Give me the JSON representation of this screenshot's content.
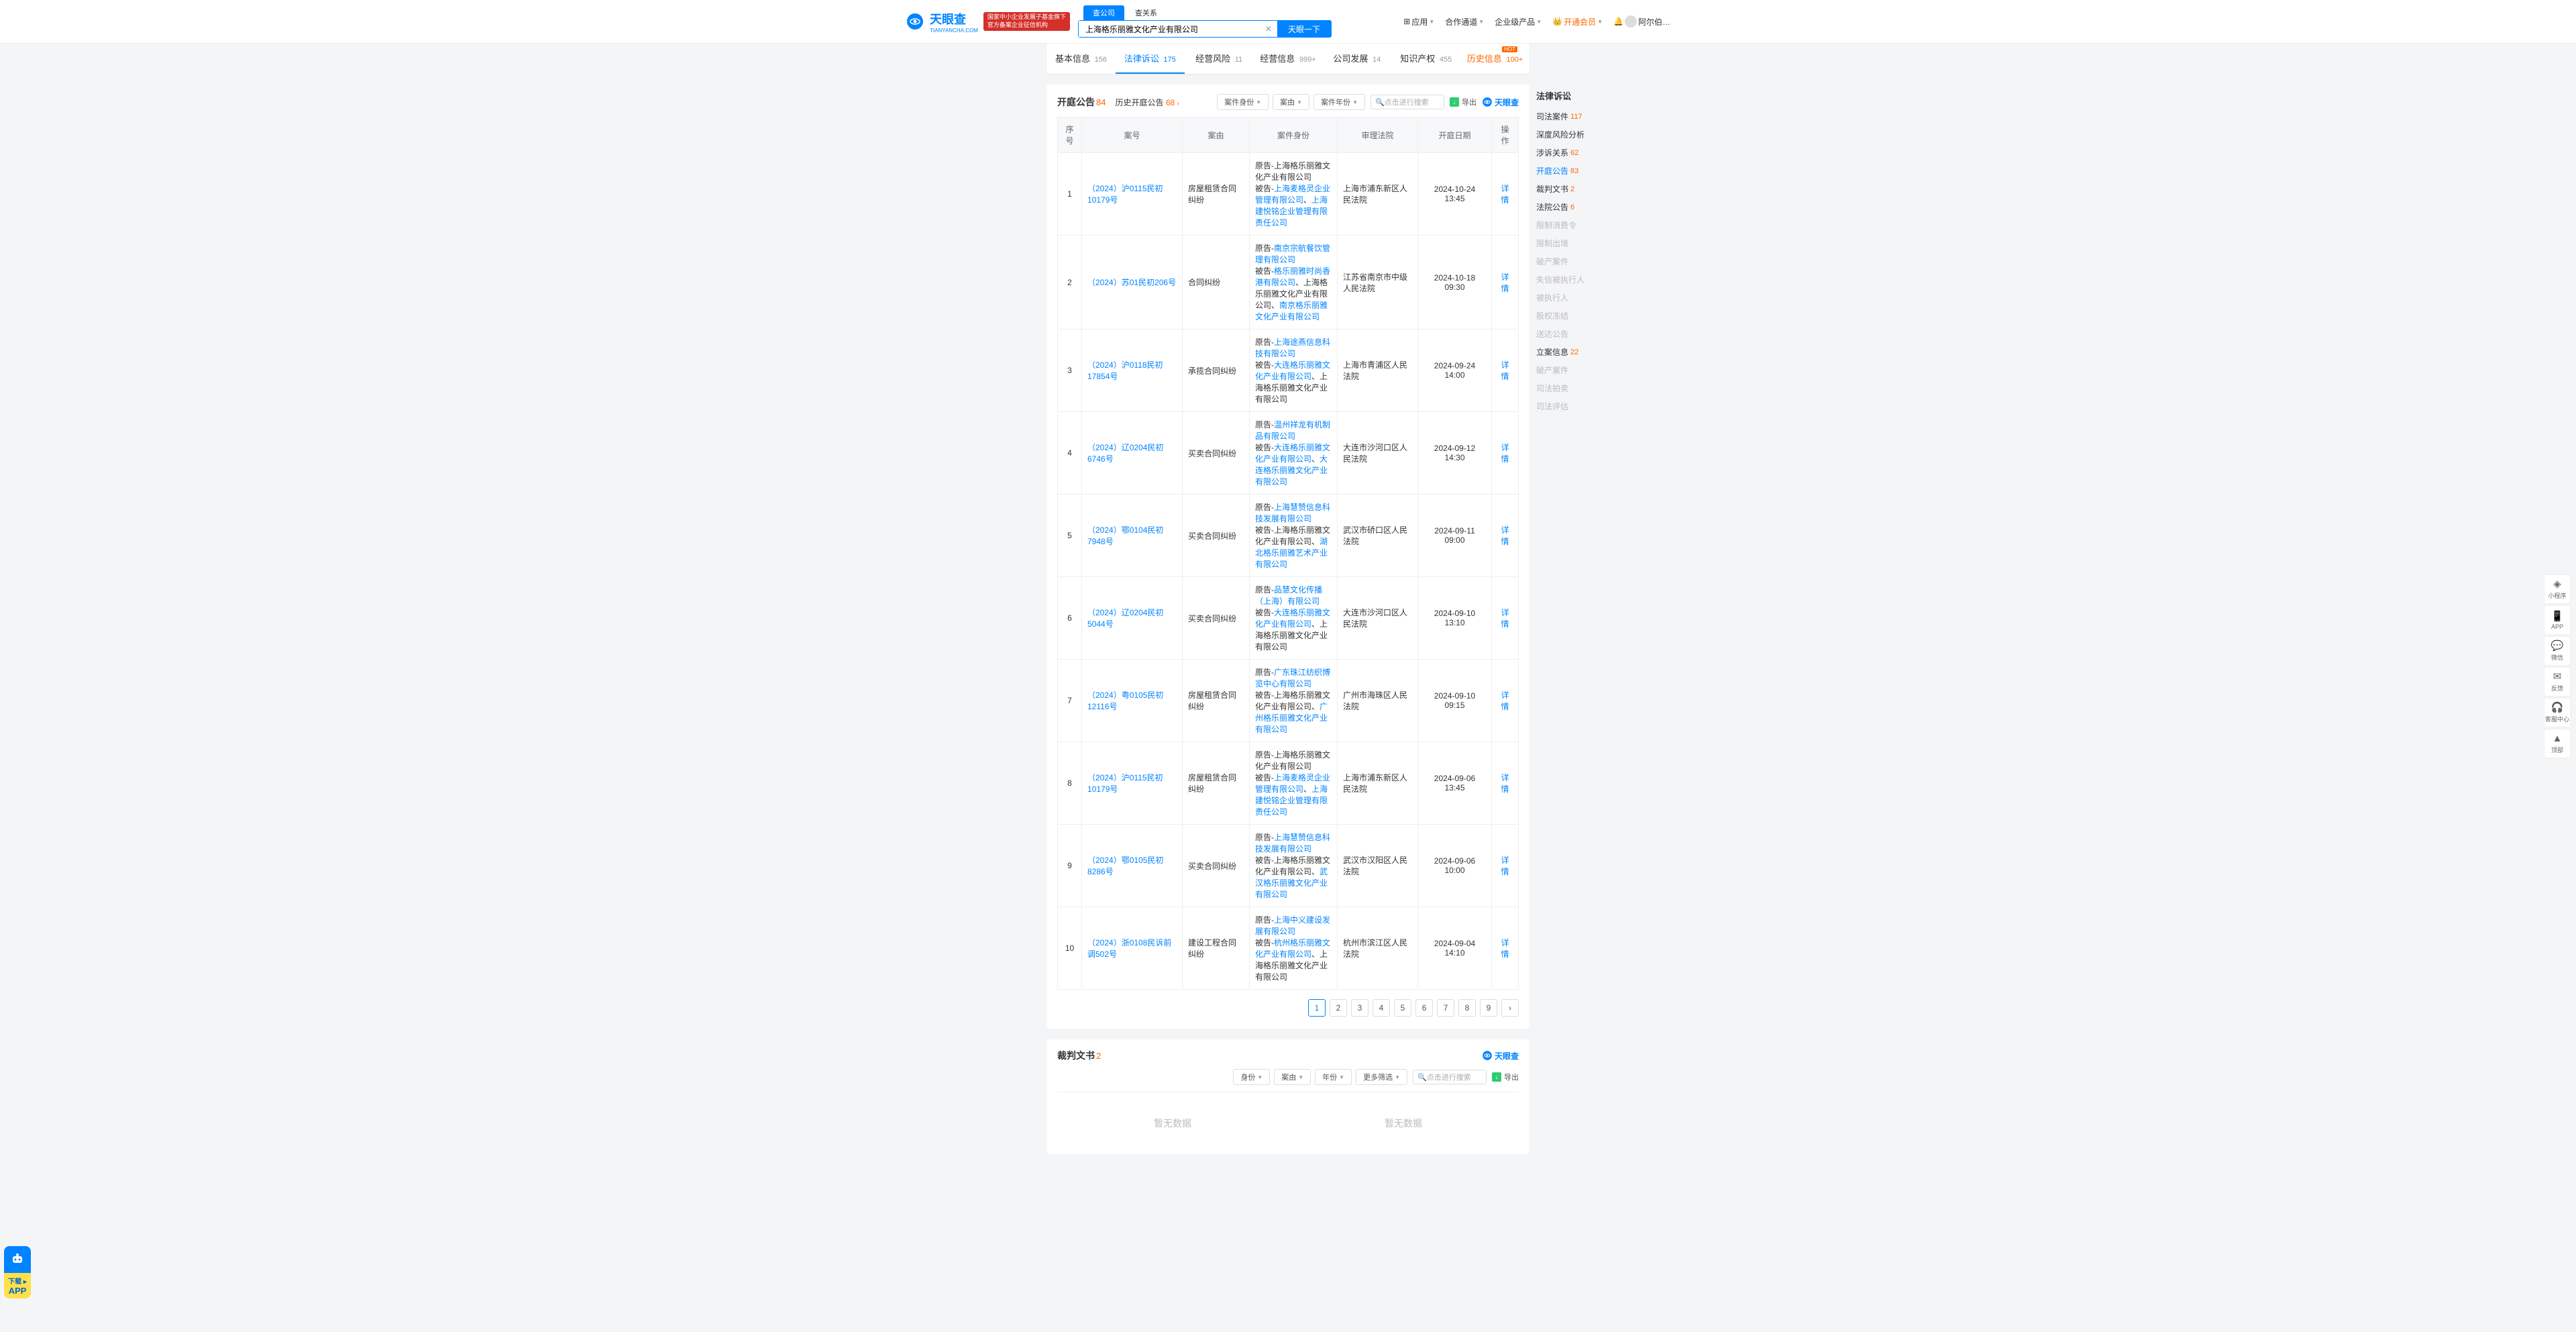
{
  "header": {
    "logo_chinese": "天眼查",
    "logo_sub": "TIANYANCHA.COM",
    "red_banner_l1": "国家中小企业发展子基金旗下",
    "red_banner_l2": "官方备案企业征信机构",
    "search_tabs": [
      "查公司",
      "查关系"
    ],
    "search_value": "上海格乐丽雅文化产业有限公司",
    "search_btn": "天眼一下",
    "nav": [
      {
        "label": "应用",
        "has_caret": true,
        "icon": "grid"
      },
      {
        "label": "合作通道",
        "has_caret": true
      },
      {
        "label": "企业级产品",
        "has_caret": true
      },
      {
        "label": "开通会员",
        "has_caret": true,
        "vip": true
      },
      {
        "label": "阿尔伯…",
        "has_caret": false,
        "avatar": true
      }
    ]
  },
  "tabs": [
    {
      "label": "基本信息",
      "count": "156"
    },
    {
      "label": "法律诉讼",
      "count": "175",
      "active": true
    },
    {
      "label": "经营风险",
      "count": "11"
    },
    {
      "label": "经营信息",
      "count": "999+"
    },
    {
      "label": "公司发展",
      "count": "14"
    },
    {
      "label": "知识产权",
      "count": "455"
    },
    {
      "label": "历史信息",
      "count": "100+",
      "history": true,
      "hot": "HOT"
    }
  ],
  "section1": {
    "title": "开庭公告",
    "count": "84",
    "sub_label": "历史开庭公告",
    "sub_count": "68",
    "filters": [
      "案件身份",
      "案由",
      "案件年份"
    ],
    "search_placeholder": "点击进行搜索",
    "export_label": "导出",
    "brand": "天眼查",
    "columns": [
      "序号",
      "案号",
      "案由",
      "案件身份",
      "审理法院",
      "开庭日期",
      "操作"
    ],
    "op_label": "详情",
    "plaintiff_label": "原告-",
    "defendant_label": "被告-",
    "sep": "、",
    "rows": [
      {
        "idx": "1",
        "case_no": "（2024）沪0115民初10179号",
        "reason": "房屋租赁合同纠纷",
        "plaintiffs": [
          {
            "name": "上海格乐丽雅文化产业有限公司",
            "link": false
          }
        ],
        "defendants": [
          {
            "name": "上海麦格灵企业管理有限公司",
            "link": true
          },
          {
            "name": "上海建悦铭企业管理有限责任公司",
            "link": true
          }
        ],
        "court": "上海市浦东新区人民法院",
        "date": "2024-10-24 13:45"
      },
      {
        "idx": "2",
        "case_no": "（2024）苏01民初206号",
        "reason": "合同纠纷",
        "plaintiffs": [
          {
            "name": "南京宗航餐饮管理有限公司",
            "link": true
          }
        ],
        "defendants": [
          {
            "name": "格乐丽雅时尚香港有限公司",
            "link": true
          },
          {
            "name": "上海格乐丽雅文化产业有限公司",
            "link": false
          },
          {
            "name": "南京格乐丽雅文化产业有限公司",
            "link": true
          }
        ],
        "court": "江苏省南京市中级人民法院",
        "date": "2024-10-18 09:30"
      },
      {
        "idx": "3",
        "case_no": "（2024）沪0118民初17854号",
        "reason": "承揽合同纠纷",
        "plaintiffs": [
          {
            "name": "上海途燕信息科技有限公司",
            "link": true
          }
        ],
        "defendants": [
          {
            "name": "大连格乐丽雅文化产业有限公司",
            "link": true
          },
          {
            "name": "上海格乐丽雅文化产业有限公司",
            "link": false
          }
        ],
        "court": "上海市青浦区人民法院",
        "date": "2024-09-24 14:00"
      },
      {
        "idx": "4",
        "case_no": "（2024）辽0204民初6746号",
        "reason": "买卖合同纠纷",
        "plaintiffs": [
          {
            "name": "温州祥龙有机制品有限公司",
            "link": true
          }
        ],
        "defendants": [
          {
            "name": "大连格乐丽雅文化产业有限公司",
            "link": true
          },
          {
            "name": "大连格乐丽雅文化产业有限公司",
            "link": true
          }
        ],
        "court": "大连市沙河口区人民法院",
        "date": "2024-09-12 14:30"
      },
      {
        "idx": "5",
        "case_no": "（2024）鄂0104民初7948号",
        "reason": "买卖合同纠纷",
        "plaintiffs": [
          {
            "name": "上海慧赞信息科技发展有限公司",
            "link": true
          }
        ],
        "defendants": [
          {
            "name": "上海格乐丽雅文化产业有限公司",
            "link": false
          },
          {
            "name": "湖北格乐丽雅艺术产业有限公司",
            "link": true
          }
        ],
        "court": "武汉市硚口区人民法院",
        "date": "2024-09-11 09:00"
      },
      {
        "idx": "6",
        "case_no": "（2024）辽0204民初5044号",
        "reason": "买卖合同纠纷",
        "plaintiffs": [
          {
            "name": "品慧文化传播（上海）有限公司",
            "link": true
          }
        ],
        "defendants": [
          {
            "name": "大连格乐丽雅文化产业有限公司",
            "link": true
          },
          {
            "name": "上海格乐丽雅文化产业有限公司",
            "link": false
          }
        ],
        "court": "大连市沙河口区人民法院",
        "date": "2024-09-10 13:10"
      },
      {
        "idx": "7",
        "case_no": "（2024）粤0105民初12116号",
        "reason": "房屋租赁合同纠纷",
        "plaintiffs": [
          {
            "name": "广东珠江纺织博览中心有限公司",
            "link": true
          }
        ],
        "defendants": [
          {
            "name": "上海格乐丽雅文化产业有限公司",
            "link": false
          },
          {
            "name": "广州格乐丽雅文化产业有限公司",
            "link": true
          }
        ],
        "court": "广州市海珠区人民法院",
        "date": "2024-09-10 09:15"
      },
      {
        "idx": "8",
        "case_no": "（2024）沪0115民初10179号",
        "reason": "房屋租赁合同纠纷",
        "plaintiffs": [
          {
            "name": "上海格乐丽雅文化产业有限公司",
            "link": false
          }
        ],
        "defendants": [
          {
            "name": "上海麦格灵企业管理有限公司",
            "link": true
          },
          {
            "name": "上海建悦铭企业管理有限责任公司",
            "link": true
          }
        ],
        "court": "上海市浦东新区人民法院",
        "date": "2024-09-06 13:45"
      },
      {
        "idx": "9",
        "case_no": "（2024）鄂0105民初8286号",
        "reason": "买卖合同纠纷",
        "plaintiffs": [
          {
            "name": "上海慧赞信息科技发展有限公司",
            "link": true
          }
        ],
        "defendants": [
          {
            "name": "上海格乐丽雅文化产业有限公司",
            "link": false
          },
          {
            "name": "武汉格乐丽雅文化产业有限公司",
            "link": true
          }
        ],
        "court": "武汉市汉阳区人民法院",
        "date": "2024-09-06 10:00"
      },
      {
        "idx": "10",
        "case_no": "（2024）浙0108民诉前调502号",
        "reason": "建设工程合同纠纷",
        "plaintiffs": [
          {
            "name": "上海中义建设发展有限公司",
            "link": true
          }
        ],
        "defendants": [
          {
            "name": "杭州格乐丽雅文化产业有限公司",
            "link": true
          },
          {
            "name": "上海格乐丽雅文化产业有限公司",
            "link": false
          }
        ],
        "court": "杭州市滨江区人民法院",
        "date": "2024-09-04 14:10"
      }
    ],
    "pages": [
      "1",
      "2",
      "3",
      "4",
      "5",
      "6",
      "7",
      "8",
      "9"
    ],
    "page_active": "1"
  },
  "section2": {
    "title": "裁判文书",
    "count": "2",
    "filters": [
      "身份",
      "案由",
      "年份",
      "更多筛选"
    ],
    "search_placeholder": "点击进行搜索",
    "export_label": "导出",
    "brand": "天眼查",
    "empty_label": "暂无数据"
  },
  "sidebar": {
    "title": "法律诉讼",
    "items": [
      {
        "label": "司法案件",
        "count": "117"
      },
      {
        "label": "深度风险分析"
      },
      {
        "label": "涉诉关系",
        "count": "62"
      },
      {
        "label": "开庭公告",
        "count": "83",
        "active": true
      },
      {
        "label": "裁判文书",
        "count": "2"
      },
      {
        "label": "法院公告",
        "count": "6"
      },
      {
        "label": "限制消费令",
        "muted": true
      },
      {
        "label": "限制出境",
        "muted": true
      },
      {
        "label": "破产案件",
        "muted": true
      },
      {
        "label": "失信被执行人",
        "muted": true
      },
      {
        "label": "被执行人",
        "muted": true
      },
      {
        "label": "股权冻结",
        "muted": true
      },
      {
        "label": "送达公告",
        "muted": true
      },
      {
        "label": "立案信息",
        "count": "22"
      },
      {
        "label": "破产案件",
        "muted": true
      },
      {
        "label": "司法拍卖",
        "muted": true
      },
      {
        "label": "司法评估",
        "muted": true
      }
    ]
  },
  "right_sticky": [
    {
      "icon": "◈",
      "label": "小程序"
    },
    {
      "icon": "📱",
      "label": "APP"
    },
    {
      "icon": "💬",
      "label": "微信"
    },
    {
      "icon": "✉",
      "label": "反馈"
    },
    {
      "icon": "🎧",
      "label": "客服中心"
    },
    {
      "icon": "▲",
      "label": "顶部"
    }
  ],
  "left_float": {
    "line1": "下载",
    "line2": "APP"
  }
}
